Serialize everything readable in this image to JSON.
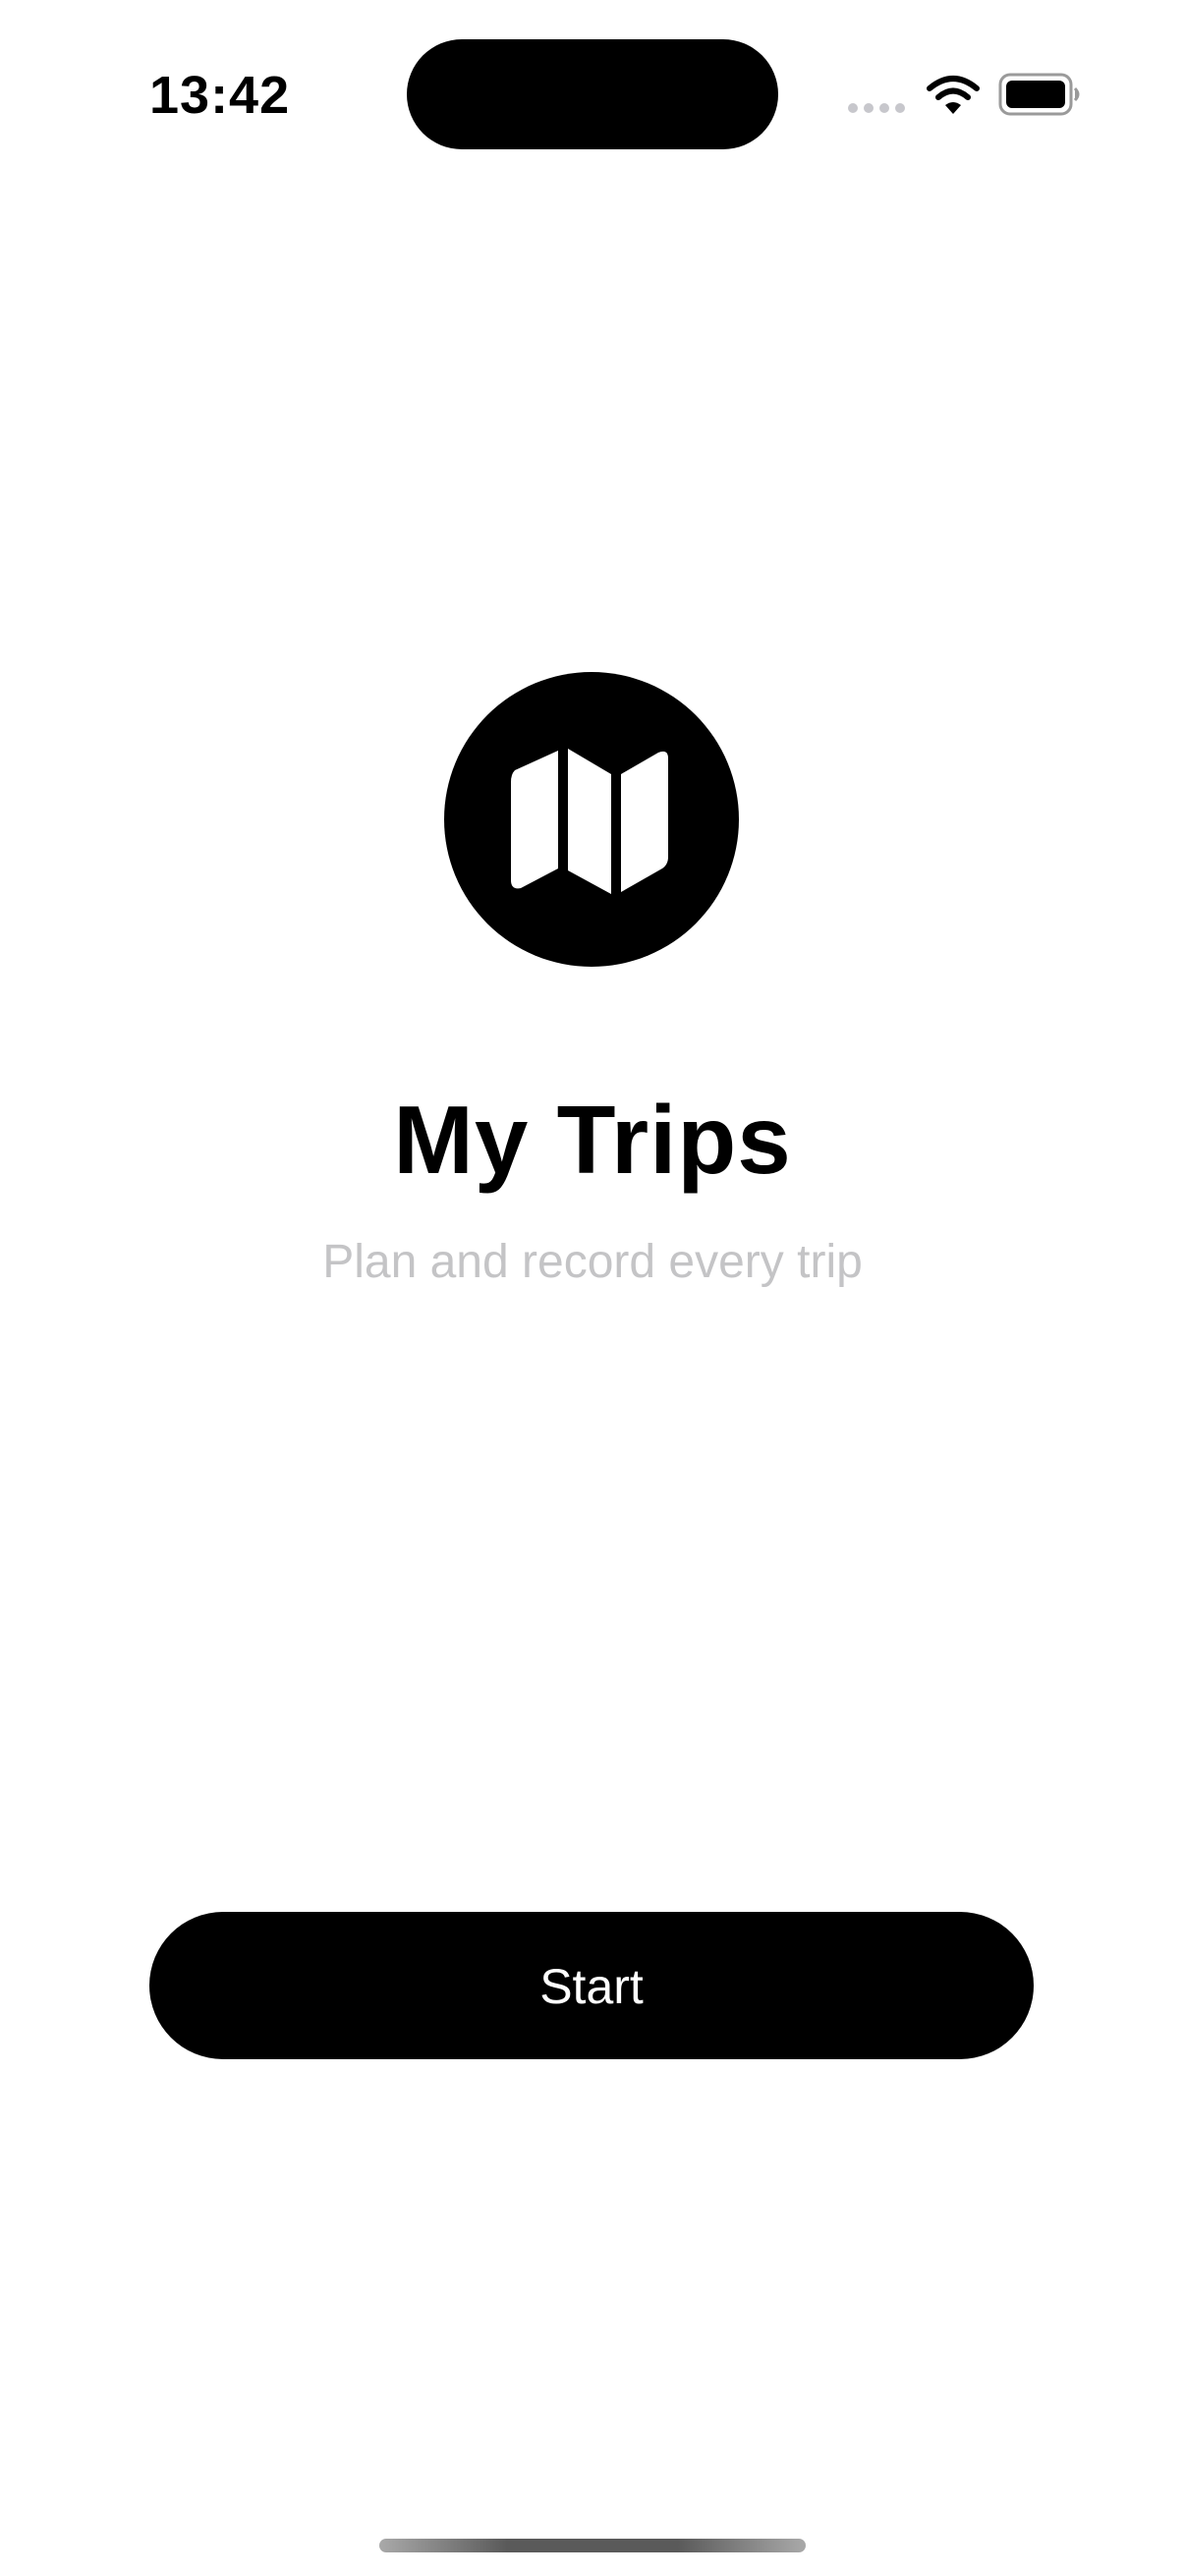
{
  "status_bar": {
    "time": "13:42",
    "icons": [
      "signal-dots-icon",
      "wifi-icon",
      "battery-icon"
    ]
  },
  "hero": {
    "icon": "map-icon",
    "title": "My Trips",
    "subtitle": "Plan and record every trip"
  },
  "actions": {
    "start_label": "Start"
  },
  "colors": {
    "background": "#ffffff",
    "primary": "#000000",
    "subtitle": "#c4c4c6",
    "button_text": "#ffffff"
  }
}
